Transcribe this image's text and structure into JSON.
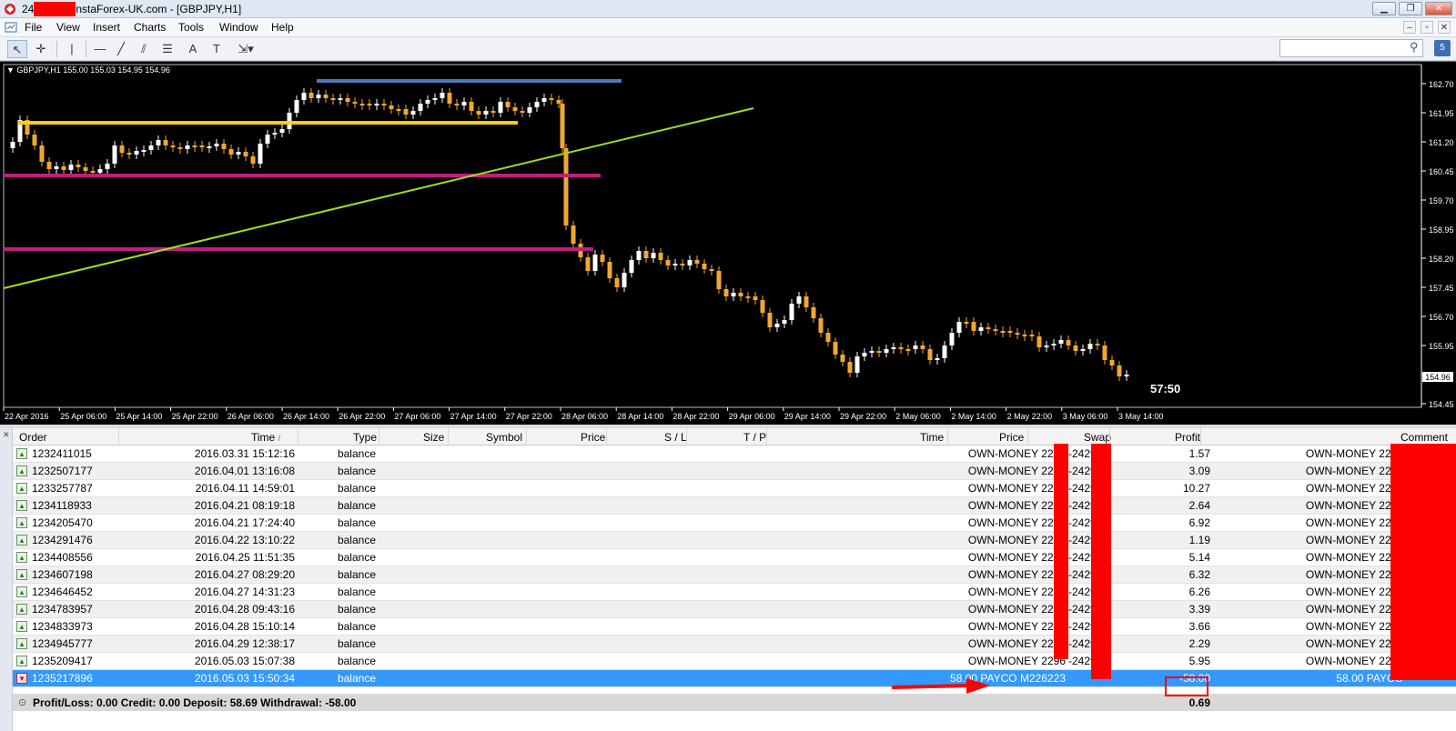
{
  "window": {
    "title_prefix": "24",
    "title_suffix": "nstaForex-UK.com - [GBPJPY,H1]",
    "controls": [
      "▁",
      "❐",
      "✕"
    ]
  },
  "menu": {
    "items": [
      "File",
      "View",
      "Insert",
      "Charts",
      "Tools",
      "Window",
      "Help"
    ],
    "mdi_controls": [
      "–",
      "▫",
      "✕"
    ]
  },
  "toolbar": {
    "tools": [
      "cursor-icon",
      "crosshair-icon",
      "vertical-line-icon",
      "horizontal-line-icon",
      "trendline-icon",
      "equidistant-channel-icon",
      "fibonacci-icon",
      "text-icon",
      "text-label-icon",
      "arrows-icon"
    ],
    "glyphs": [
      "↖",
      "✛",
      "|",
      "—",
      "╱",
      "⫽",
      "☰",
      "A",
      "T",
      "⇲"
    ],
    "search_placeholder": "",
    "news_glyph": "5"
  },
  "chart": {
    "info": "GBPJPY,H1  155.00 155.03 154.95 154.96",
    "timer": "57:50",
    "current_price": "154.96",
    "price_labels": [
      "162.70",
      "161.95",
      "161.20",
      "160.45",
      "159.70",
      "158.95",
      "158.20",
      "157.45",
      "156.70",
      "155.95",
      "155.20",
      "154.45"
    ],
    "time_labels": [
      "22 Apr 2016",
      "25 Apr 06:00",
      "25 Apr 14:00",
      "25 Apr 22:00",
      "26 Apr 06:00",
      "26 Apr 14:00",
      "26 Apr 22:00",
      "27 Apr 06:00",
      "27 Apr 14:00",
      "27 Apr 22:00",
      "28 Apr 06:00",
      "28 Apr 14:00",
      "28 Apr 22:00",
      "29 Apr 06:00",
      "29 Apr 14:00",
      "29 Apr 22:00",
      "2 May 06:00",
      "2 May 14:00",
      "2 May 22:00",
      "3 May 06:00",
      "3 May 14:00"
    ],
    "colors": {
      "background": "#000000",
      "bull": "#ffffff",
      "bear": "#f0a830",
      "hline_yellow": "#ffd000",
      "hline_blue": "#4a78b4",
      "hline_magenta": "#c01f7a",
      "trend": "#9ee01e"
    }
  },
  "terminal": {
    "headers": {
      "order": "Order",
      "time": "Time",
      "sort": "/",
      "type": "Type",
      "size": "Size",
      "symbol": "Symbol",
      "price": "Price",
      "sl": "S / L",
      "tp": "T / P",
      "time2": "Time",
      "price2": "Price",
      "swap": "Swap",
      "profit": "Profit",
      "comment": "Comment"
    },
    "rows": [
      {
        "order": "1232411015",
        "time": "2016.03.31 15:12:16",
        "type": "balance",
        "price2": "OWN-MONEY 2296",
        "swap": "-2429",
        "profit": "1.57",
        "comment": "OWN-MONEY 2296"
      },
      {
        "order": "1232507177",
        "time": "2016.04.01 13:16:08",
        "type": "balance",
        "price2": "OWN-MONEY 2296",
        "swap": "-2429",
        "profit": "3.09",
        "comment": "OWN-MONEY 2296"
      },
      {
        "order": "1233257787",
        "time": "2016.04.11 14:59:01",
        "type": "balance",
        "price2": "OWN-MONEY 2296",
        "swap": "-2429",
        "profit": "10.27",
        "comment": "OWN-MONEY 2296"
      },
      {
        "order": "1234118933",
        "time": "2016.04.21 08:19:18",
        "type": "balance",
        "price2": "OWN-MONEY 2296",
        "swap": "-2429",
        "profit": "2.64",
        "comment": "OWN-MONEY 2296"
      },
      {
        "order": "1234205470",
        "time": "2016.04.21 17:24:40",
        "type": "balance",
        "price2": "OWN-MONEY 2296",
        "swap": "-2429",
        "profit": "6.92",
        "comment": "OWN-MONEY 2296"
      },
      {
        "order": "1234291476",
        "time": "2016.04.22 13:10:22",
        "type": "balance",
        "price2": "OWN-MONEY 2296",
        "swap": "-2429",
        "profit": "1.19",
        "comment": "OWN-MONEY 2296"
      },
      {
        "order": "1234408556",
        "time": "2016.04.25 11:51:35",
        "type": "balance",
        "price2": "OWN-MONEY 2296",
        "swap": "-2429",
        "profit": "5.14",
        "comment": "OWN-MONEY 2296"
      },
      {
        "order": "1234607198",
        "time": "2016.04.27 08:29:20",
        "type": "balance",
        "price2": "OWN-MONEY 2296",
        "swap": "-2429",
        "profit": "6.32",
        "comment": "OWN-MONEY 2296"
      },
      {
        "order": "1234646452",
        "time": "2016.04.27 14:31:23",
        "type": "balance",
        "price2": "OWN-MONEY 2296",
        "swap": "-2429",
        "profit": "6.26",
        "comment": "OWN-MONEY 2296"
      },
      {
        "order": "1234783957",
        "time": "2016.04.28 09:43:16",
        "type": "balance",
        "price2": "OWN-MONEY 2296",
        "swap": "-2429",
        "profit": "3.39",
        "comment": "OWN-MONEY 2296"
      },
      {
        "order": "1234833973",
        "time": "2016.04.28 15:10:14",
        "type": "balance",
        "price2": "OWN-MONEY 2296",
        "swap": "-2429",
        "profit": "3.66",
        "comment": "OWN-MONEY 2296"
      },
      {
        "order": "1234945777",
        "time": "2016.04.29 12:38:17",
        "type": "balance",
        "price2": "OWN-MONEY 2296",
        "swap": "-2429",
        "profit": "2.29",
        "comment": "OWN-MONEY 2296"
      },
      {
        "order": "1235209417",
        "time": "2016.05.03 15:07:38",
        "type": "balance",
        "price2": "OWN-MONEY 2296",
        "swap": "-2429",
        "profit": "5.95",
        "comment": "OWN-MONEY 2296"
      },
      {
        "order": "1235217896",
        "time": "2016.05.03 15:50:34",
        "type": "balance",
        "price2": "58.00 PAYCO M226223",
        "swap": "",
        "profit": "-58.00",
        "comment": "58.00 PAYCO",
        "selected": true
      }
    ],
    "summary": "Profit/Loss: 0.00  Credit: 0.00  Deposit: 58.69  Withdrawal: -58.00",
    "summary_total": "0.69"
  }
}
